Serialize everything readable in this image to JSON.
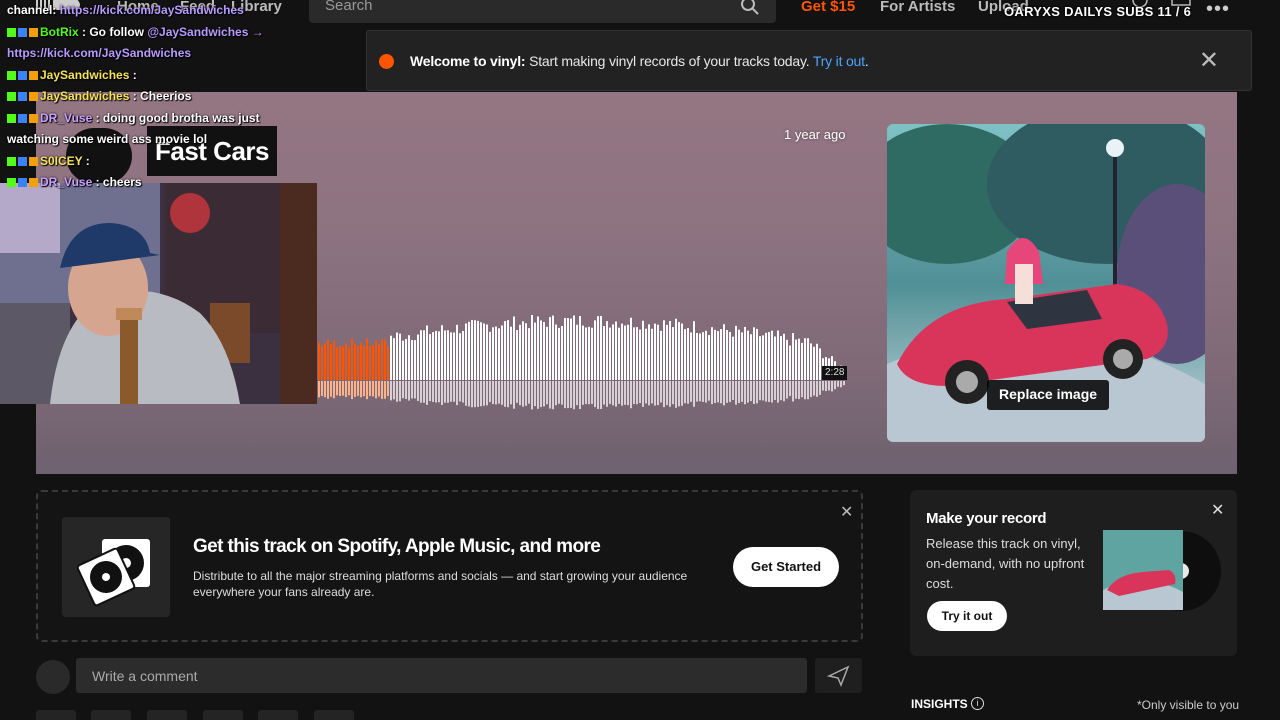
{
  "nav": {
    "home": "Home",
    "feed": "Feed",
    "library": "Library",
    "search_placeholder": "Search",
    "get15": "Get $15",
    "for_artists": "For Artists",
    "upload": "Upload"
  },
  "overlay": {
    "subs_counter": "OARYXS DAILYS SUBS 11 / 6"
  },
  "banner": {
    "bold": "Welcome to vinyl:",
    "text": " Start making vinyl records of your tracks today. ",
    "link": "Try it out",
    "period": "."
  },
  "track": {
    "title": "Fast Cars",
    "posted": "1 year ago",
    "duration": "2:28",
    "replace_image": "Replace image",
    "progress_fraction": 0.14
  },
  "chat": [
    {
      "user": "",
      "text": "channel: ",
      "link": "https://kick.com/JaySandwiches",
      "color": "green"
    },
    {
      "user": "BotRix",
      "text": " : Go follow ",
      "link": "@JaySandwiches →",
      "color": "green"
    },
    {
      "user": "",
      "text": "",
      "link": "https://kick.com/JaySandwiches",
      "color": "green"
    },
    {
      "user": "JaySandwiches",
      "text": " : ",
      "link": "",
      "color": "yellow"
    },
    {
      "user": "JaySandwiches",
      "text": " : Cheerios",
      "link": "",
      "color": "yellow"
    },
    {
      "user": "DR_Vuse",
      "text": " : doing good brotha was just",
      "link": "",
      "color": "purple"
    },
    {
      "user": "",
      "text": "watching some weird ass movie lol",
      "link": "",
      "color": "purple"
    },
    {
      "user": "S0ICEY",
      "text": " : ",
      "link": "",
      "color": "yellow"
    },
    {
      "user": "DR_Vuse",
      "text": " : cheers",
      "link": "",
      "color": "purple"
    }
  ],
  "distro": {
    "title": "Get this track on Spotify, Apple Music, and more",
    "desc": "Distribute to all the major streaming platforms and socials — and start growing your audience everywhere your fans already are.",
    "button": "Get Started"
  },
  "vinyl": {
    "title": "Make your record",
    "desc": "Release this track on vinyl, on-demand, with no upfront cost.",
    "button": "Try it out"
  },
  "comment": {
    "placeholder": "Write a comment"
  },
  "insights": {
    "label": "INSIGHTS",
    "note": "*Only visible to you"
  },
  "colors": {
    "accent": "#ff5500",
    "link": "#4da3ff"
  }
}
